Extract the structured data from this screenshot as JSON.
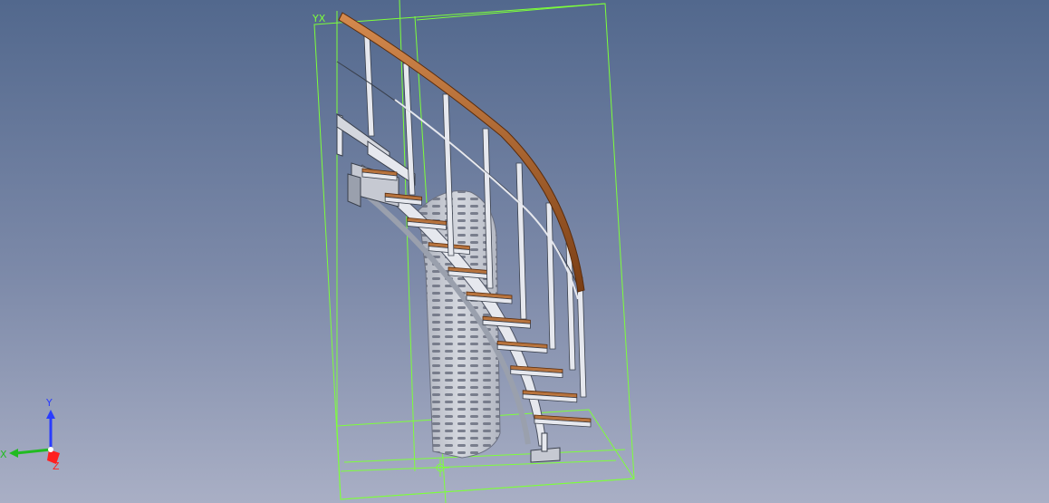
{
  "viewport": {
    "background_top": "#52688d",
    "background_bottom": "#a9afc5"
  },
  "colors": {
    "bounding_box": "#7dff3a",
    "handrail": "#b8682f",
    "handrail_dark": "#7a3e14",
    "metal": "#e6e8ee",
    "metal_shade": "#9aa0ad",
    "tread_wood": "#b8743e",
    "perforated_panel": "#c6c9d2",
    "perforation": "#6b7080",
    "axis_x": "#22bb22",
    "axis_y": "#2a3cff",
    "axis_z": "#ff2020"
  },
  "model": {
    "name": "spiral-staircase",
    "baluster_count": 8,
    "tread_count": 11
  },
  "triad": {
    "x_label": "X",
    "y_label": "Y",
    "z_label": "Z"
  },
  "bbox_labels": {
    "corner_axes": "YX"
  }
}
